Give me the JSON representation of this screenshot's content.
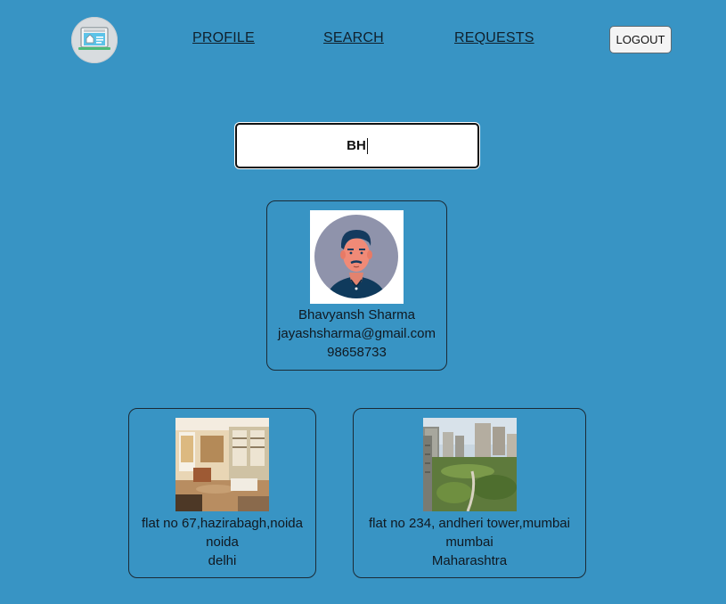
{
  "nav": {
    "logo_icon": "house-laptop-logo-icon",
    "links": [
      "PROFILE",
      "SEARCH",
      "REQUESTS"
    ],
    "logout_label": "LOGOUT"
  },
  "search": {
    "value": "BH"
  },
  "user_result": {
    "avatar_icon": "user-avatar-icon",
    "name": "Bhavyansh Sharma",
    "email": "jayashsharma@gmail.com",
    "phone": "98658733"
  },
  "properties": [
    {
      "image_icon": "living-room-photo",
      "address": "flat no 67,hazirabagh,noida",
      "city": "noida",
      "state": "delhi"
    },
    {
      "image_icon": "apartment-towers-photo",
      "address": "flat no 234, andheri tower,mumbai",
      "city": "mumbai",
      "state": "Maharashtra"
    }
  ],
  "colors": {
    "background": "#3894c4",
    "card_border": "#1b2a35"
  }
}
